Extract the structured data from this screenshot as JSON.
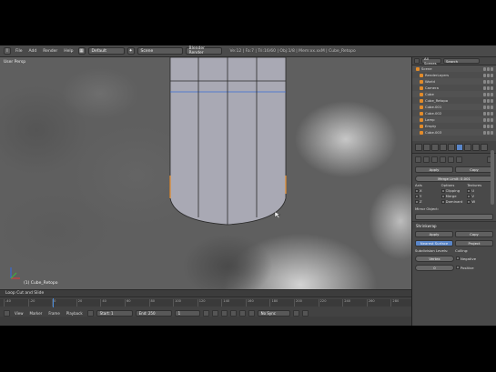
{
  "header": {
    "menus": [
      "File",
      "Add",
      "Render",
      "Help"
    ],
    "screen_layout": "Default",
    "scene": "Scene",
    "render_engine": "Blender Render",
    "stats": "Ve:12 | Fa:7 | Tri:16/60 | Obj:1/8 | Mem:xx.xxM | Cube_Retopo"
  },
  "viewport": {
    "label": "User Persp",
    "object_label": "(1) Cube_Retopo",
    "colors": {
      "mesh_face": "#a9a9b4",
      "mesh_edge": "#2a2a2a",
      "selected_edge": "#e48b2a"
    }
  },
  "operator": {
    "label": "Loop Cut and Slide"
  },
  "timeline": {
    "ticks": [
      "-40",
      "-20",
      "0",
      "20",
      "40",
      "60",
      "80",
      "100",
      "120",
      "140",
      "160",
      "180",
      "200",
      "220",
      "240",
      "260",
      "280"
    ],
    "menus": [
      "View",
      "Marker",
      "Frame",
      "Playback"
    ],
    "start": "Start: 1",
    "end": "End: 250",
    "current": "1",
    "sync": "No Sync"
  },
  "outliner": {
    "view": "All Scenes",
    "search_placeholder": "Search",
    "items": [
      "Scene",
      "RenderLayers",
      "World",
      "Camera",
      "Cube",
      "Cube_Retopo",
      "Cube.001",
      "Cube.002",
      "Lamp",
      "Empty",
      "Cube.003"
    ]
  },
  "properties": {
    "buttons": {
      "apply": "Apply",
      "copy": "Copy"
    },
    "modifier_field": "Merge Limit: 0.001",
    "axis_label": "Axis",
    "options_label": "Options",
    "textures_label": "Textures",
    "axes": [
      "X",
      "Y",
      "Z"
    ],
    "options": [
      "Clipping",
      "Merge",
      "Dominant"
    ],
    "texture_axes": [
      "U",
      "V",
      "W"
    ],
    "mirror_object_label": "Mirror Object:",
    "section_title": "Shrinkwrap",
    "apply2": "Apply",
    "copy2": "Copy",
    "mode_active": "Nearest Surface",
    "mode_other": "Project",
    "target_label": "Target:",
    "offset_label": "Offset:",
    "vertex_field": "Vertex",
    "offset_value": "0.000",
    "subdiv_label": "Subdivision Levels:",
    "levels": "0",
    "culling_label": "Culling:",
    "cull_options": [
      "Negative",
      "Positive"
    ]
  }
}
